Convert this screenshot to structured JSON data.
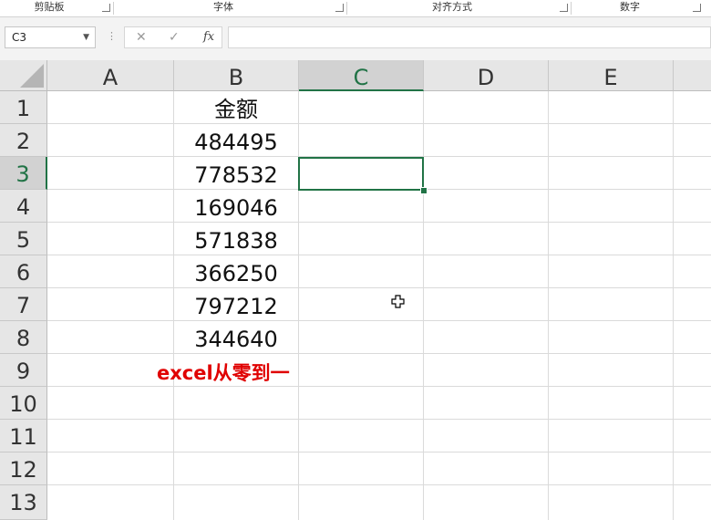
{
  "ribbon": {
    "groups": [
      {
        "label": "剪贴板"
      },
      {
        "label": "字体"
      },
      {
        "label": "对齐方式"
      },
      {
        "label": "数字"
      }
    ]
  },
  "formula_bar": {
    "name_box": "C3",
    "cancel_glyph": "✕",
    "enter_glyph": "✓",
    "fx_label": "fx",
    "formula": ""
  },
  "sheet": {
    "columns": [
      "A",
      "B",
      "C",
      "D",
      "E"
    ],
    "rows": [
      "1",
      "2",
      "3",
      "4",
      "5",
      "6",
      "7",
      "8",
      "9",
      "10",
      "11",
      "12",
      "13"
    ],
    "selected_cell": "C3",
    "selection_color": "#217346",
    "column_b": [
      "金额",
      "484495",
      "778532",
      "169046",
      "571838",
      "366250",
      "797212",
      "344640"
    ]
  },
  "watermark": {
    "text": "excel从零到一",
    "color": "#e00000"
  },
  "cursor": {
    "icon": "cell-cross-cursor-icon"
  }
}
